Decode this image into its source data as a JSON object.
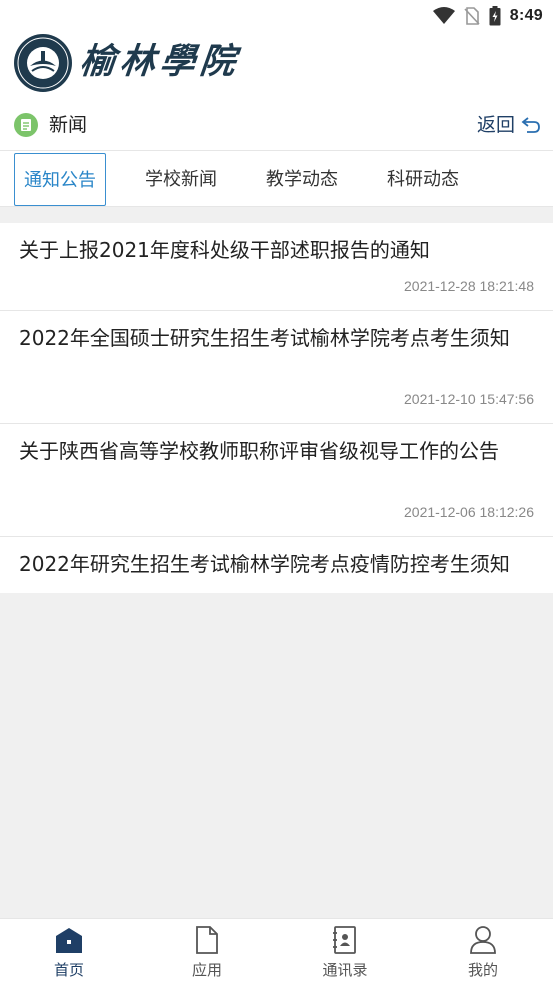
{
  "status_bar": {
    "time": "8:49",
    "icons": [
      "wifi-icon",
      "no-sim-icon",
      "battery-charging-icon"
    ]
  },
  "header": {
    "logo_text": "榆林學院",
    "logo_seal_icon": "university-seal-icon"
  },
  "section": {
    "title": "新闻",
    "back_label": "返回"
  },
  "tabs": [
    {
      "label": "通知公告",
      "active": true
    },
    {
      "label": "学校新闻",
      "active": false
    },
    {
      "label": "教学动态",
      "active": false
    },
    {
      "label": "科研动态",
      "active": false
    }
  ],
  "news": [
    {
      "title": "关于上报2021年度科处级干部述职报告的通知",
      "date": "2021-12-28 18:21:48"
    },
    {
      "title": "2022年全国硕士研究生招生考试榆林学院考点考生须知",
      "date": "2021-12-10 15:47:56"
    },
    {
      "title": "关于陕西省高等学校教师职称评审省级视导工作的公告",
      "date": "2021-12-06 18:12:26"
    },
    {
      "title": "2022年研究生招生考试榆林学院考点疫情防控考生须知",
      "date": ""
    }
  ],
  "bottom_nav": [
    {
      "label": "首页",
      "icon": "home-icon",
      "active": true
    },
    {
      "label": "应用",
      "icon": "document-icon",
      "active": false
    },
    {
      "label": "通讯录",
      "icon": "contacts-book-icon",
      "active": false
    },
    {
      "label": "我的",
      "icon": "user-icon",
      "active": false
    }
  ],
  "colors": {
    "accent": "#2a86c8",
    "nav_active": "#1f3f66",
    "section_dot": "#7cc46a",
    "background_gray": "#f0f0f0"
  }
}
